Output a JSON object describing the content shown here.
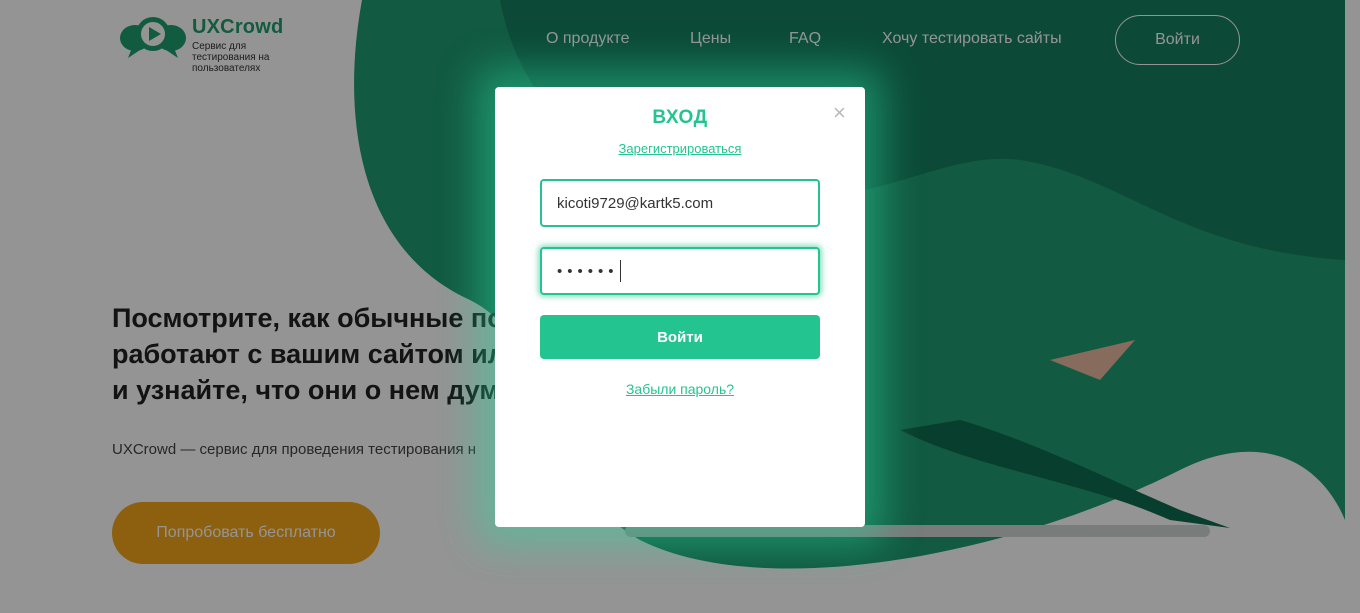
{
  "logo": {
    "name": "UXCrowd",
    "tagline": "Сервис для тестирования на пользователях"
  },
  "nav": {
    "items": [
      "О продукте",
      "Цены",
      "FAQ",
      "Хочу тестировать сайты"
    ],
    "login_label": "Войти"
  },
  "hero": {
    "title_line1": "Посмотрите, как обычные по",
    "title_line2": "работают с вашим сайтом ил",
    "title_line3": "и узнайте, что они о нем дум",
    "description": "UXCrowd — сервис для проведения тестирования н",
    "cta_label": "Попробовать бесплатно"
  },
  "modal": {
    "title": "ВХОД",
    "close_symbol": "×",
    "register_link": "Зарегистрироваться",
    "email_value": "kicoti9729@kartk5.com",
    "password_mask": "••••••",
    "submit_label": "Войти",
    "forgot_link": "Забыли пароль?"
  },
  "colors": {
    "accent": "#24c490",
    "brand_dark": "#12775a",
    "cta": "#f2a61a"
  }
}
